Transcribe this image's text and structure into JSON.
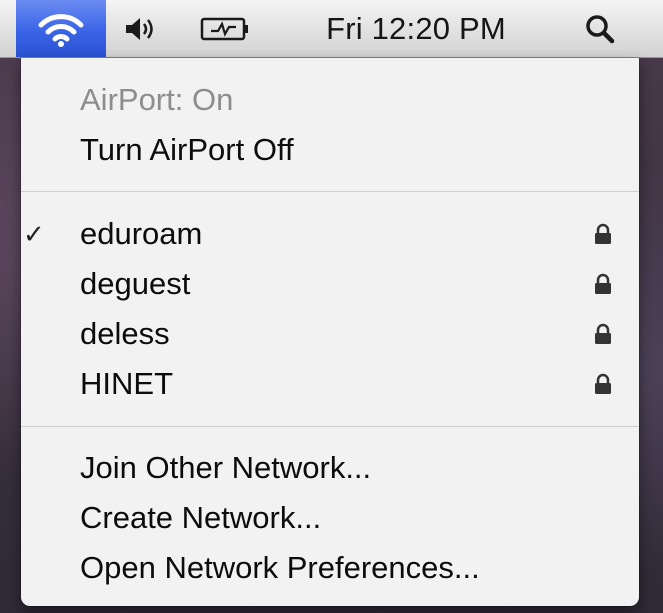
{
  "menubar": {
    "wifi_icon": "wifi-icon",
    "volume_icon": "volume-icon",
    "battery_icon": "battery-charging-icon",
    "clock": "Fri 12:20 PM",
    "spotlight_icon": "spotlight-search-icon",
    "wifi_highlight_color": "#3a64e6"
  },
  "menu": {
    "status": "AirPort: On",
    "toggle": "Turn AirPort Off",
    "networks": [
      {
        "name": "eduroam",
        "checked": true,
        "locked": true
      },
      {
        "name": "deguest",
        "checked": false,
        "locked": true
      },
      {
        "name": "deless",
        "checked": false,
        "locked": true
      },
      {
        "name": "HINET",
        "checked": false,
        "locked": true
      }
    ],
    "check_mark": "✓",
    "lock_icon": "lock-icon",
    "actions": [
      "Join Other Network...",
      "Create Network...",
      "Open Network Preferences..."
    ]
  }
}
